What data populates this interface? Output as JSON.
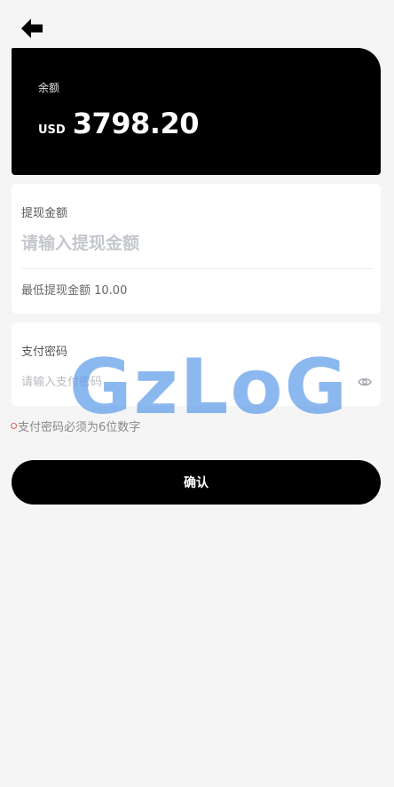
{
  "header": {
    "back_icon": "arrow-left-icon"
  },
  "balance": {
    "label": "余额",
    "currency": "USD",
    "amount": "3798.20"
  },
  "withdraw": {
    "label": "提现金额",
    "placeholder": "请输入提现金额",
    "value": "",
    "min_text": "最低提现金额 10.00"
  },
  "password": {
    "label": "支付密码",
    "placeholder": "请输入支付密码",
    "value": "",
    "toggle_icon": "eye-icon"
  },
  "error": {
    "message": "支付密码必须为6位数字"
  },
  "confirm": {
    "label": "确认"
  },
  "watermark": {
    "text": "GzLoG"
  },
  "colors": {
    "background": "#f5f5f5",
    "card": "#ffffff",
    "primary": "#000000",
    "watermark": "#609cea",
    "error_dot": "#e05a5a"
  }
}
